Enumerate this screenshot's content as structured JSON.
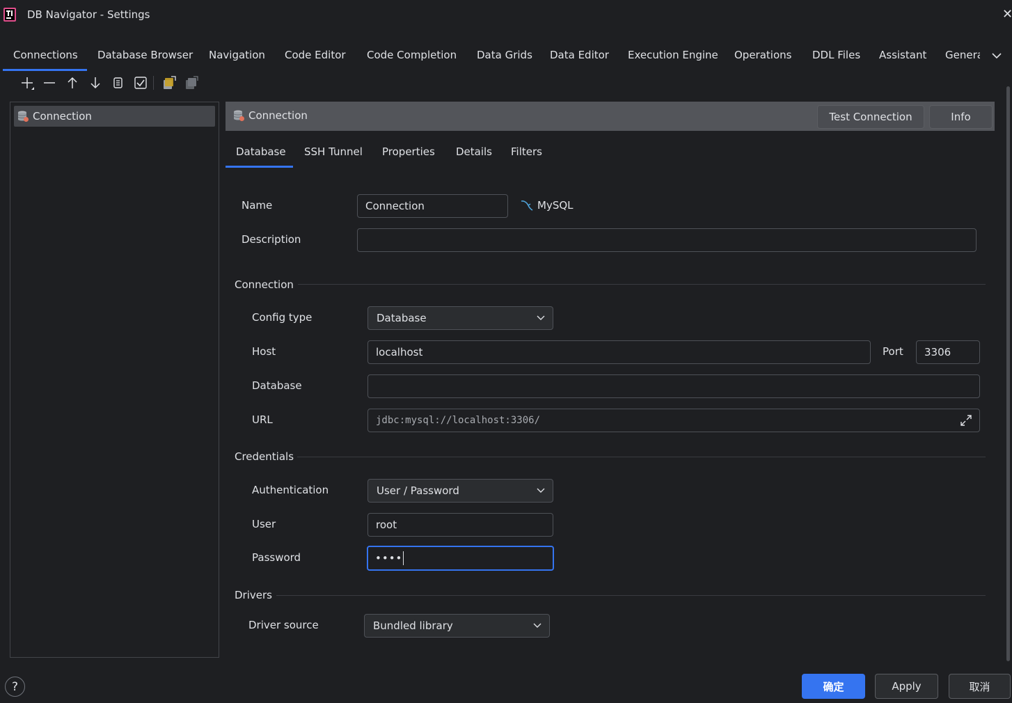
{
  "window": {
    "title": "DB Navigator - Settings"
  },
  "top_tabs": [
    {
      "label": "Connections"
    },
    {
      "label": "Database Browser"
    },
    {
      "label": "Navigation"
    },
    {
      "label": "Code Editor"
    },
    {
      "label": "Code Completion"
    },
    {
      "label": "Data Grids"
    },
    {
      "label": "Data Editor"
    },
    {
      "label": "Execution Engine"
    },
    {
      "label": "Operations"
    },
    {
      "label": "DDL Files"
    },
    {
      "label": "Assistant"
    },
    {
      "label": "Genera"
    }
  ],
  "connections_list": {
    "items": [
      {
        "label": "Connection"
      }
    ]
  },
  "detail": {
    "header_title": "Connection",
    "test_connection_label": "Test Connection",
    "info_label": "Info",
    "tabs": [
      {
        "label": "Database"
      },
      {
        "label": "SSH Tunnel"
      },
      {
        "label": "Properties"
      },
      {
        "label": "Details"
      },
      {
        "label": "Filters"
      }
    ]
  },
  "form": {
    "name_label": "Name",
    "name_value": "Connection",
    "db_type": "MySQL",
    "description_label": "Description",
    "description_value": "",
    "connection_section": "Connection",
    "config_type_label": "Config type",
    "config_type_value": "Database",
    "host_label": "Host",
    "host_value": "localhost",
    "port_label": "Port",
    "port_value": "3306",
    "database_label": "Database",
    "database_value": "",
    "url_label": "URL",
    "url_value": "jdbc:mysql://localhost:3306/",
    "credentials_section": "Credentials",
    "authentication_label": "Authentication",
    "authentication_value": "User / Password",
    "user_label": "User",
    "user_value": "root",
    "password_label": "Password",
    "password_value": "••••",
    "drivers_section": "Drivers",
    "driver_source_label": "Driver source",
    "driver_source_value": "Bundled library"
  },
  "footer": {
    "help_label": "?",
    "ok_label": "确定",
    "apply_label": "Apply",
    "cancel_label": "取消"
  },
  "colors": {
    "accent": "#3574f0",
    "background": "#1e1f22",
    "header": "#53555a",
    "mysql": "#4fa3d9"
  }
}
